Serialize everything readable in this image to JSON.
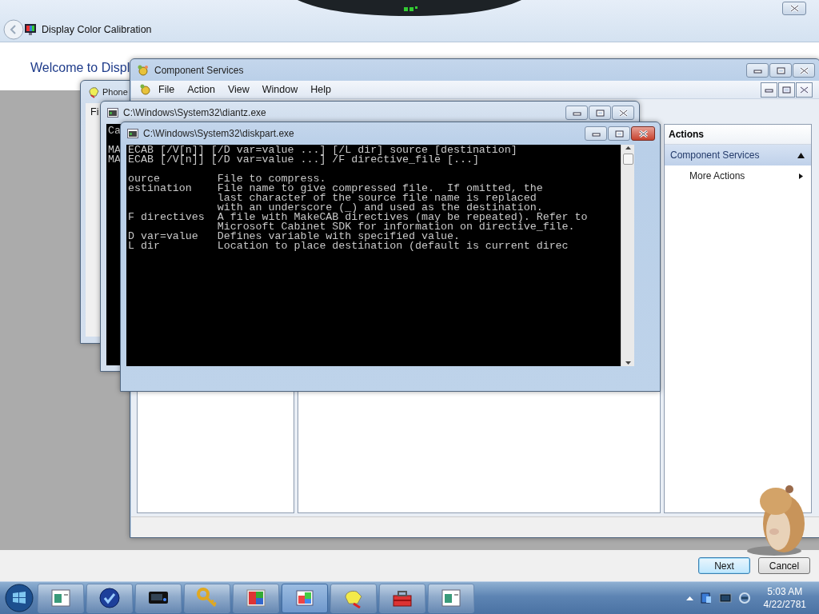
{
  "wizard": {
    "title": "Display Color Calibration",
    "heading": "Welcome to Displ",
    "buttons": [
      {
        "label": "Next",
        "default": true
      },
      {
        "label": "Cancel",
        "default": false
      }
    ]
  },
  "phone_window": {
    "title": "Phone",
    "menu": [
      "Fi"
    ]
  },
  "component_services": {
    "title": "Component Services",
    "menu": [
      "File",
      "Action",
      "View",
      "Window",
      "Help"
    ],
    "actions": {
      "title": "Actions",
      "items": [
        {
          "label": "Component Services",
          "kind": "header"
        },
        {
          "label": "More Actions",
          "kind": "submenu"
        }
      ]
    }
  },
  "diantz_window": {
    "title": "C:\\Windows\\System32\\diantz.exe",
    "lines": [
      "Ca",
      "MA",
      "MA"
    ]
  },
  "diskpart_window": {
    "title": "C:\\Windows\\System32\\diskpart.exe",
    "usage": [
      "ECAB [/V[n]] [/D var=value ...] [/L dir] source [destination]",
      "ECAB [/V[n]] [/D var=value ...] /F directive_file [...]"
    ],
    "options": [
      "ource         File to compress.",
      "estination    File name to give compressed file.  If omitted, the",
      "              last character of the source file name is replaced",
      "              with an underscore (_) and used as the destination.",
      "F directives  A file with MakeCAB directives (may be repeated). Refer to",
      "              Microsoft Cabinet SDK for information on directive_file.",
      "D var=value   Defines variable with specified value.",
      "L dir         Location to place destination (default is current direc"
    ]
  },
  "taskbar": {
    "time": "5:03 AM",
    "date": "4/22/2781"
  }
}
